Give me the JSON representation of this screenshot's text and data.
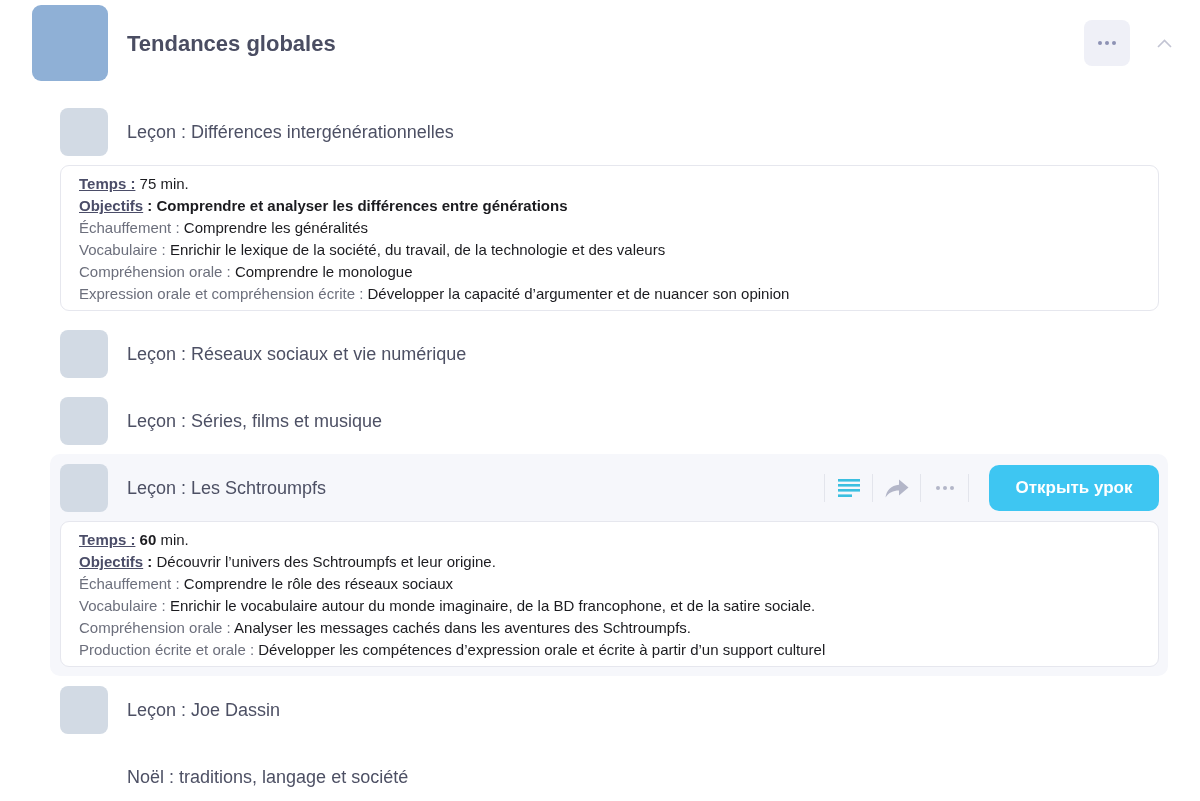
{
  "course": {
    "title": "Tendances globales",
    "expanded": true
  },
  "lessons": [
    {
      "title": "Leçon : Différences intergénérationnelles",
      "thumbnail": true,
      "hovered": false,
      "expanded": true,
      "details": [
        {
          "kind": "heading",
          "label": "Temps :",
          "value": "75 min."
        },
        {
          "kind": "heading",
          "label": "Objectifs",
          "value": "**: Comprendre et analyser les différences entre générations**"
        },
        {
          "kind": "field",
          "label": "Échauffement :",
          "value": "Comprendre les généralités"
        },
        {
          "kind": "field",
          "label": "Vocabulaire :",
          "value": "Enrichir le lexique de la société, du travail, de la technologie et des valeurs"
        },
        {
          "kind": "field",
          "label": "Compréhension orale :",
          "value": "Comprendre le monologue"
        },
        {
          "kind": "field",
          "label": "Expression orale et compréhension écrite :",
          "value": "Développer la capacité d’argumenter et de nuancer son opinion"
        }
      ]
    },
    {
      "title": "Leçon : Réseaux sociaux et vie numérique",
      "thumbnail": true,
      "hovered": false,
      "expanded": false
    },
    {
      "title": "Leçon : Séries, films et musique",
      "thumbnail": true,
      "hovered": false,
      "expanded": false
    },
    {
      "title": "Leçon : Les Schtroumpfs",
      "thumbnail": true,
      "hovered": true,
      "expanded": true,
      "open_button": "Открыть урок",
      "details": [
        {
          "kind": "heading",
          "label": "Temps :",
          "value": "**60** min."
        },
        {
          "kind": "heading",
          "label": "Objectifs",
          "value": "**:** Découvrir l’univers des Schtroumpfs et leur origine."
        },
        {
          "kind": "field",
          "label": "Échauffement :",
          "value": "Comprendre le rôle des réseaux sociaux"
        },
        {
          "kind": "field",
          "label": "Vocabulaire :",
          "value": "Enrichir le vocabulaire autour du monde imaginaire, de la BD francophone, et de la satire sociale."
        },
        {
          "kind": "field",
          "label": "Compréhension orale :",
          "value": "Analyser les messages cachés dans les aventures des Schtroumpfs."
        },
        {
          "kind": "field",
          "label": "Production écrite et orale :",
          "value": "Développer les compétences d’expression orale et écrite à partir d’un support culturel"
        }
      ]
    },
    {
      "title": "Leçon : Joe Dassin",
      "thumbnail": true,
      "hovered": false,
      "expanded": false
    },
    {
      "title": "Noël : traditions, langage et société",
      "thumbnail": false,
      "hovered": false,
      "expanded": false
    }
  ]
}
